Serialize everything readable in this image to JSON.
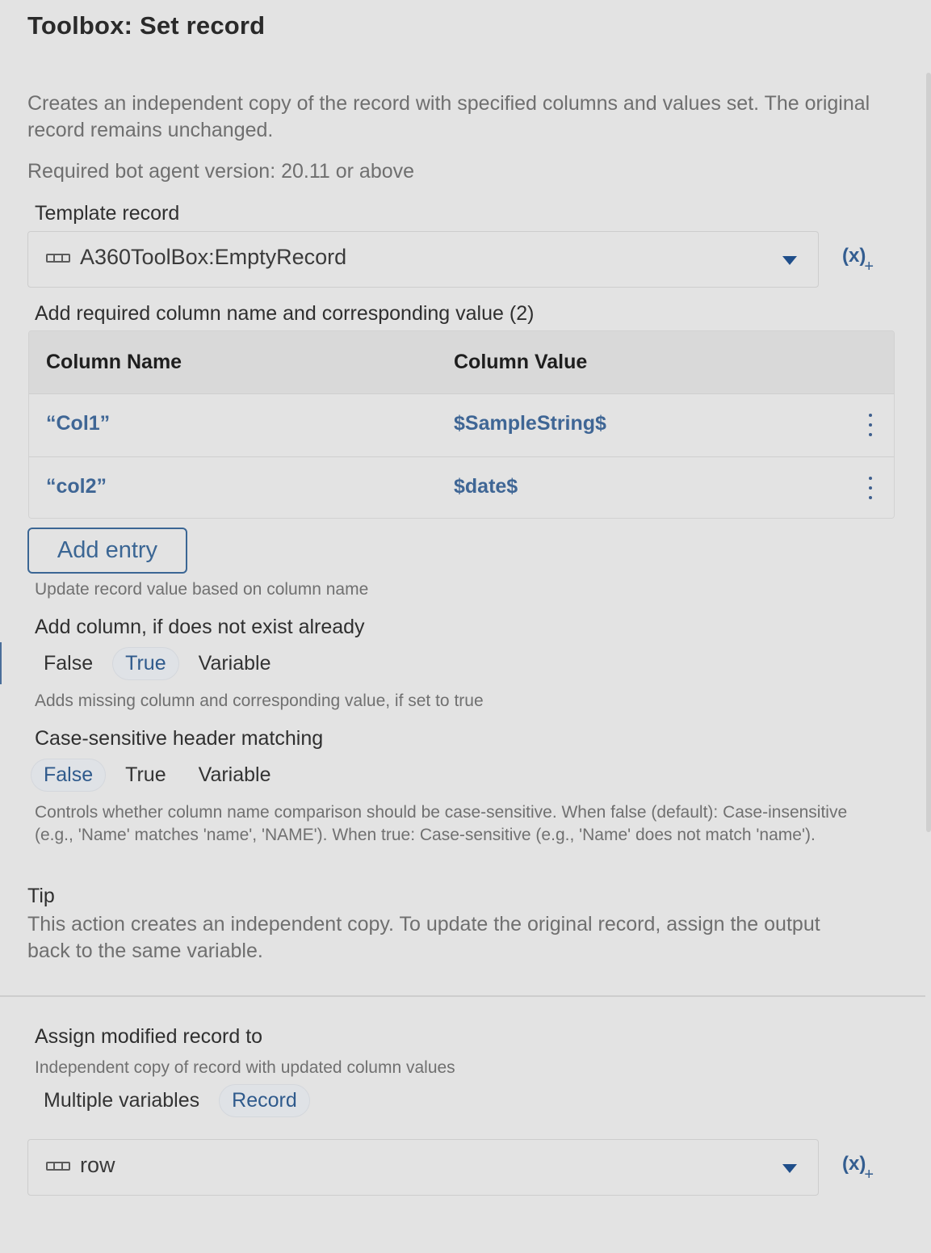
{
  "header": {
    "title": "Toolbox: Set record"
  },
  "description": "Creates an independent copy of the record with specified columns and values set. The original record remains unchanged.",
  "required_version": "Required bot agent version: 20.11 or above",
  "template_record": {
    "label": "Template record",
    "value": "A360ToolBox:EmptyRecord",
    "icon": "record-icon",
    "var_button": "(x)",
    "var_plus": "+"
  },
  "columns": {
    "label": "Add required column name and corresponding value (2)",
    "headers": {
      "name": "Column Name",
      "value": "Column Value"
    },
    "rows": [
      {
        "name": "“Col1”",
        "value": "$SampleString$"
      },
      {
        "name": "“col2”",
        "value": "$date$"
      }
    ],
    "add_button": "Add entry",
    "help": "Update record value based on column name"
  },
  "add_column": {
    "label": "Add column, if does not exist already",
    "options": [
      "False",
      "True",
      "Variable"
    ],
    "selected": "True",
    "help": "Adds missing column and corresponding value, if set to true"
  },
  "case_sensitive": {
    "label": "Case-sensitive header matching",
    "options": [
      "False",
      "True",
      "Variable"
    ],
    "selected": "False",
    "help": "Controls whether column name comparison should be case-sensitive. When false (default): Case-insensitive (e.g., 'Name' matches 'name', 'NAME'). When true: Case-sensitive (e.g., 'Name' does not match 'name')."
  },
  "tip": {
    "title": "Tip",
    "text": "This action creates an independent copy. To update the original record, assign the output back to the same variable."
  },
  "assign": {
    "label": "Assign modified record to",
    "help": "Independent copy of record with updated column values",
    "options": [
      "Multiple variables",
      "Record"
    ],
    "selected": "Record",
    "value": "row",
    "icon": "record-icon",
    "var_button": "(x)",
    "var_plus": "+"
  },
  "colors": {
    "accent": "#3b6694",
    "background": "#e3e3e3",
    "header_bg": "#d9d9d9"
  }
}
